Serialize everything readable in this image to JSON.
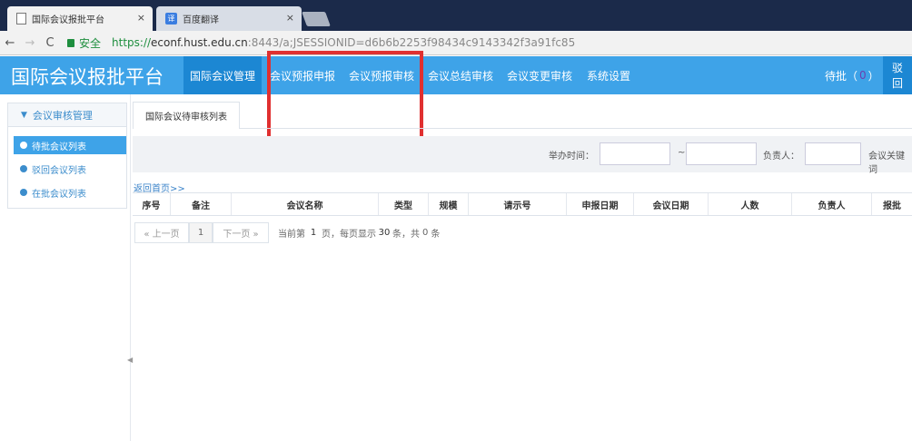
{
  "browser": {
    "tabs": [
      {
        "title": "国际会议报批平台",
        "close": "×"
      },
      {
        "title": "百度翻译",
        "icon_text": "译",
        "close": "×"
      }
    ],
    "nav_back": "←",
    "nav_forward": "→",
    "nav_reload": "C",
    "secure_label": "安全",
    "url_scheme": "https://",
    "url_host": "econf.hust.edu.cn",
    "url_rest": ":8443/a;JSESSIONID=d6b6b2253f98434c9143342f3a91fc85"
  },
  "header": {
    "brand": "国际会议报批平台",
    "nav": [
      "国际会议管理",
      "会议预报申报",
      "会议预报审核",
      "会议总结审核",
      "会议变更审核",
      "系统设置"
    ],
    "pending_label": "待批（",
    "pending_count": "0",
    "pending_close": "）",
    "return_label": "驳回"
  },
  "sidebar": {
    "title": "会议审核管理",
    "items": [
      "待批会议列表",
      "驳回会议列表",
      "在批会议列表"
    ]
  },
  "content": {
    "tab_label": "国际会议待审核列表",
    "filter": {
      "date_label": "举办时间：",
      "date_sep": "~",
      "owner_label": "负责人：",
      "keyword_label": "会议关键词"
    },
    "back_home": "返回首页>>",
    "columns": [
      "序号",
      "备注",
      "会议名称",
      "类型",
      "规模",
      "请示号",
      "申报日期",
      "会议日期",
      "人数",
      "负责人",
      "报批"
    ],
    "pager": {
      "prev": "« 上一页",
      "page": "1",
      "next": "下一页 »",
      "current_prefix": "当前第",
      "current_page": "1",
      "per_page_mid": "页，每页显示",
      "per_page": "30",
      "total_mid": "条，共",
      "total": "0",
      "total_suffix": "条"
    }
  },
  "colors": {
    "header_bg": "#3ea3e8",
    "nav_active_bg": "#1c87d3",
    "highlight_box": "#e03030",
    "secure_green": "#1e8e3e"
  }
}
